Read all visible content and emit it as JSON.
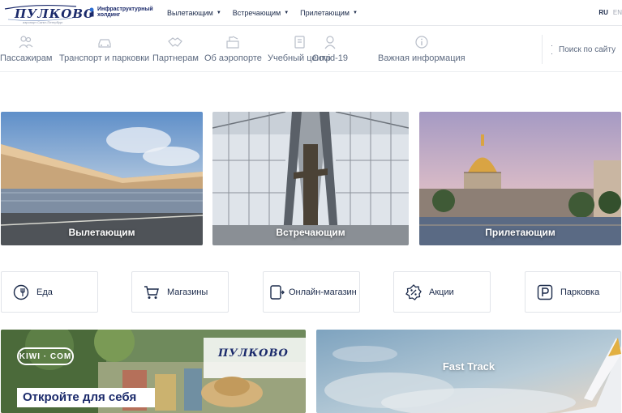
{
  "header": {
    "logo_text": "ПУЛКОВО",
    "logo_subtitle": "аэропорт Санкт-Петербург",
    "holding_line1": "Инфраструктурный",
    "holding_line2": "холдинг",
    "nav": [
      {
        "label": "Вылетающим"
      },
      {
        "label": "Встречающим"
      },
      {
        "label": "Прилетающим"
      }
    ],
    "lang_ru": "RU",
    "lang_en": "EN"
  },
  "secondary_nav": {
    "items": [
      {
        "label": "Пассажирам",
        "icon": "passengers-icon"
      },
      {
        "label": "Транспорт и парковки",
        "icon": "car-icon"
      },
      {
        "label": "Партнерам",
        "icon": "handshake-icon"
      },
      {
        "label": "Об аэропорте",
        "icon": "airport-icon"
      },
      {
        "label": "Учебный центр",
        "icon": "training-icon"
      },
      {
        "label": "Covid-19",
        "icon": "covid-icon"
      },
      {
        "label": "Важная информация",
        "icon": "info-icon"
      }
    ],
    "search_placeholder": "Поиск по сайту"
  },
  "hero_cards": [
    {
      "label": "Вылетающим"
    },
    {
      "label": "Встречающим"
    },
    {
      "label": "Прилетающим"
    }
  ],
  "quick_links": [
    {
      "label": "Еда",
      "icon": "food-icon"
    },
    {
      "label": "Магазины",
      "icon": "cart-icon"
    },
    {
      "label": "Онлайн-магазин",
      "icon": "online-shop-icon"
    },
    {
      "label": "Акции",
      "icon": "percent-icon"
    },
    {
      "label": "Парковка",
      "icon": "parking-icon"
    }
  ],
  "promos": {
    "kiwi": {
      "brand": "KIWI · COM",
      "partner_logo": "ПУЛКОВО",
      "tagline": "Откройте для себя"
    },
    "fasttrack": {
      "label": "Fast Track"
    }
  },
  "colors": {
    "brand": "#1b2a6b",
    "nav_text": "#5d6a80",
    "border": "#e1e4e9"
  }
}
